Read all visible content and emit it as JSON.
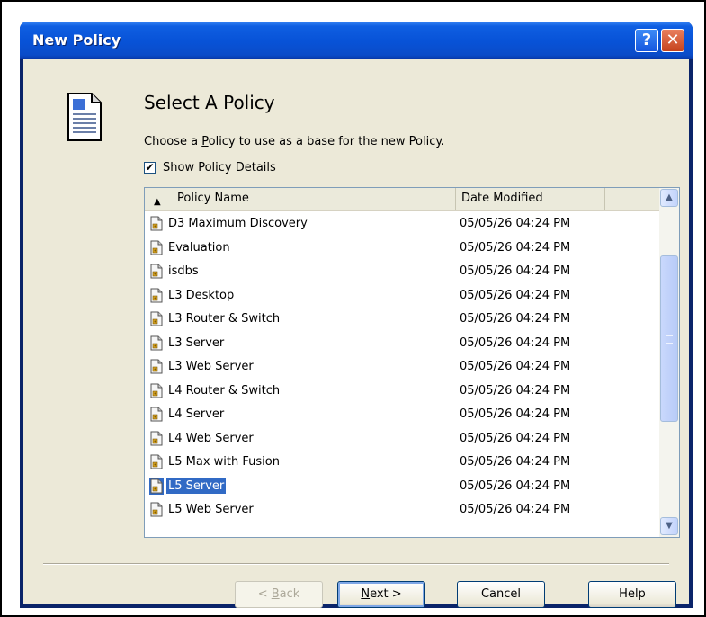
{
  "window": {
    "title": "New Policy",
    "help_glyph": "?",
    "close_glyph": "✕"
  },
  "page": {
    "heading": "Select A Policy",
    "instruction_pre": "Choose a ",
    "instruction_u": "P",
    "instruction_post": "olicy to use as a base for the new Policy.",
    "show_details_label": "Show Policy Details",
    "show_details_checked": true
  },
  "table": {
    "columns": [
      "Policy Name",
      "Date Modified"
    ],
    "sort_column": "Policy Name",
    "sort_direction": "ascending",
    "rows": [
      {
        "name": "D3 Maximum Discovery",
        "date": "05/05/26 04:24 PM"
      },
      {
        "name": "Evaluation",
        "date": "05/05/26 04:24 PM"
      },
      {
        "name": "isdbs",
        "date": "05/05/26 04:24 PM"
      },
      {
        "name": "L3 Desktop",
        "date": "05/05/26 04:24 PM"
      },
      {
        "name": "L3 Router & Switch",
        "date": "05/05/26 04:24 PM"
      },
      {
        "name": "L3 Server",
        "date": "05/05/26 04:24 PM"
      },
      {
        "name": "L3 Web Server",
        "date": "05/05/26 04:24 PM"
      },
      {
        "name": "L4 Router & Switch",
        "date": "05/05/26 04:24 PM"
      },
      {
        "name": "L4 Server",
        "date": "05/05/26 04:24 PM"
      },
      {
        "name": "L4 Web Server",
        "date": "05/05/26 04:24 PM"
      },
      {
        "name": "L5 Max with Fusion",
        "date": "05/05/26 04:24 PM"
      },
      {
        "name": "L5 Server",
        "date": "05/05/26 04:24 PM"
      },
      {
        "name": "L5 Web Server",
        "date": "05/05/26 04:24 PM"
      }
    ],
    "selected_row": 11
  },
  "buttons": {
    "back": {
      "pre": "< ",
      "u": "B",
      "post": "ack"
    },
    "next": {
      "pre": "",
      "u": "N",
      "post": "ext >"
    },
    "cancel": "Cancel",
    "help": "Help"
  },
  "colors": {
    "title_bar": "#0853d8",
    "selection": "#316ac5",
    "dialog_bg": "#ece9d8"
  },
  "icons": {
    "header": "document-icon",
    "row": "policy-file-icon"
  }
}
